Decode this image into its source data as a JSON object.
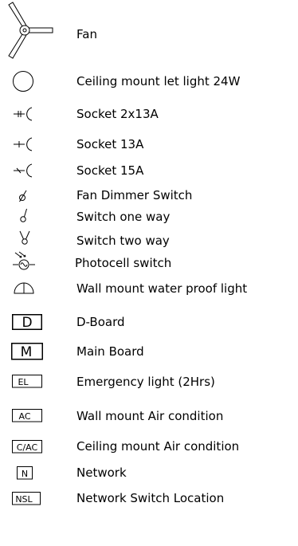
{
  "legend": {
    "items": [
      {
        "symbol": "fan-symbol-icon",
        "label": "Fan"
      },
      {
        "symbol": "ceiling-light-symbol-icon",
        "label": "Ceiling mount let light 24W"
      },
      {
        "symbol": "socket-2x13a-symbol-icon",
        "label": "Socket 2x13A"
      },
      {
        "symbol": "socket-13a-symbol-icon",
        "label": "Socket 13A"
      },
      {
        "symbol": "socket-15a-symbol-icon",
        "label": "Socket 15A"
      },
      {
        "symbol": "fan-dimmer-switch-symbol-icon",
        "label": "Fan Dimmer Switch"
      },
      {
        "symbol": "switch-one-way-symbol-icon",
        "label": "Switch one way"
      },
      {
        "symbol": "switch-two-way-symbol-icon",
        "label": "Switch two way"
      },
      {
        "symbol": "photocell-switch-symbol-icon",
        "label": "Photocell switch"
      },
      {
        "symbol": "wall-waterproof-light-symbol-icon",
        "label": "Wall mount water proof light"
      },
      {
        "symbol": "d-board-symbol-icon",
        "label": "D-Board",
        "box_text": "D"
      },
      {
        "symbol": "main-board-symbol-icon",
        "label": "Main Board",
        "box_text": "M"
      },
      {
        "symbol": "emergency-light-symbol-icon",
        "label": "Emergency light (2Hrs)",
        "box_text": "EL"
      },
      {
        "symbol": "wall-air-condition-symbol-icon",
        "label": "Wall mount Air condition",
        "box_text": "AC"
      },
      {
        "symbol": "ceiling-air-condition-symbol-icon",
        "label": "Ceiling mount Air condition",
        "box_text": "C/AC"
      },
      {
        "symbol": "network-symbol-icon",
        "label": "Network",
        "box_text": "N"
      },
      {
        "symbol": "network-switch-location-symbol-icon",
        "label": "Network Switch Location",
        "box_text": "NSL"
      }
    ]
  }
}
